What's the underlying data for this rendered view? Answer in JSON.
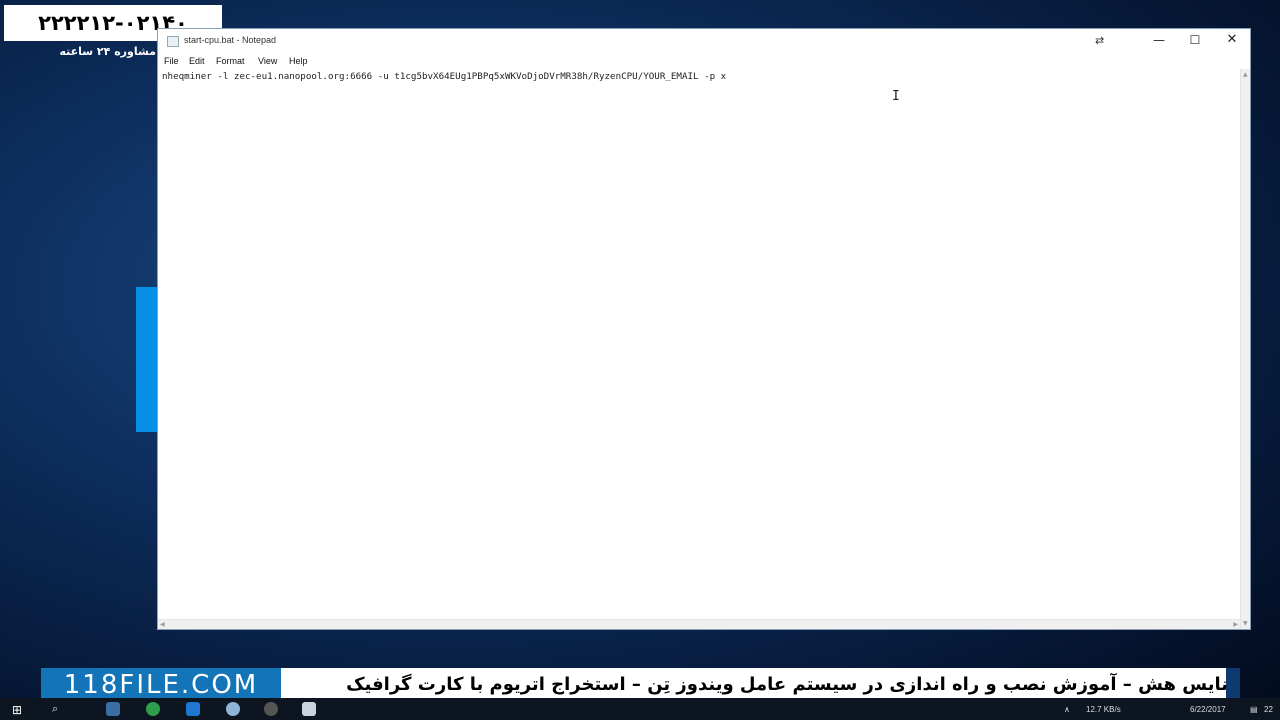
{
  "overlay": {
    "phone": "٠٢١-٢٢٢٢١٢۴٠",
    "consult": "مشاوره ۲۴ ساعته"
  },
  "window": {
    "title": "start-cpu.bat - Notepad",
    "controls": {
      "minimize": "—",
      "maximize": "☐",
      "close": "✕"
    }
  },
  "menu": {
    "items": [
      "File",
      "Edit",
      "Format",
      "View",
      "Help"
    ]
  },
  "editor": {
    "content": "nheqminer -l zec-eu1.nanopool.org:6666 -u t1cg5bvX64EUg1PBPq5xWKVoDjoDVrMR38h/RyzenCPU/YOUR_EMAIL -p x"
  },
  "banner": {
    "site": "118FILE.COM",
    "text": "نایس هش – آموزش نصب و راه اندازی در سیستم عامل ویندوز تِن – استخراج اتریوم با کارت گرافیک"
  },
  "taskbar": {
    "network_speed": "12.7 KB/s",
    "date": "6/22/2017",
    "notification_count": "22"
  },
  "colors": {
    "banner_site_bg": "#1474b8",
    "desktop_accent": "#0a8fe8",
    "taskbar_bg": "#0d1520"
  }
}
